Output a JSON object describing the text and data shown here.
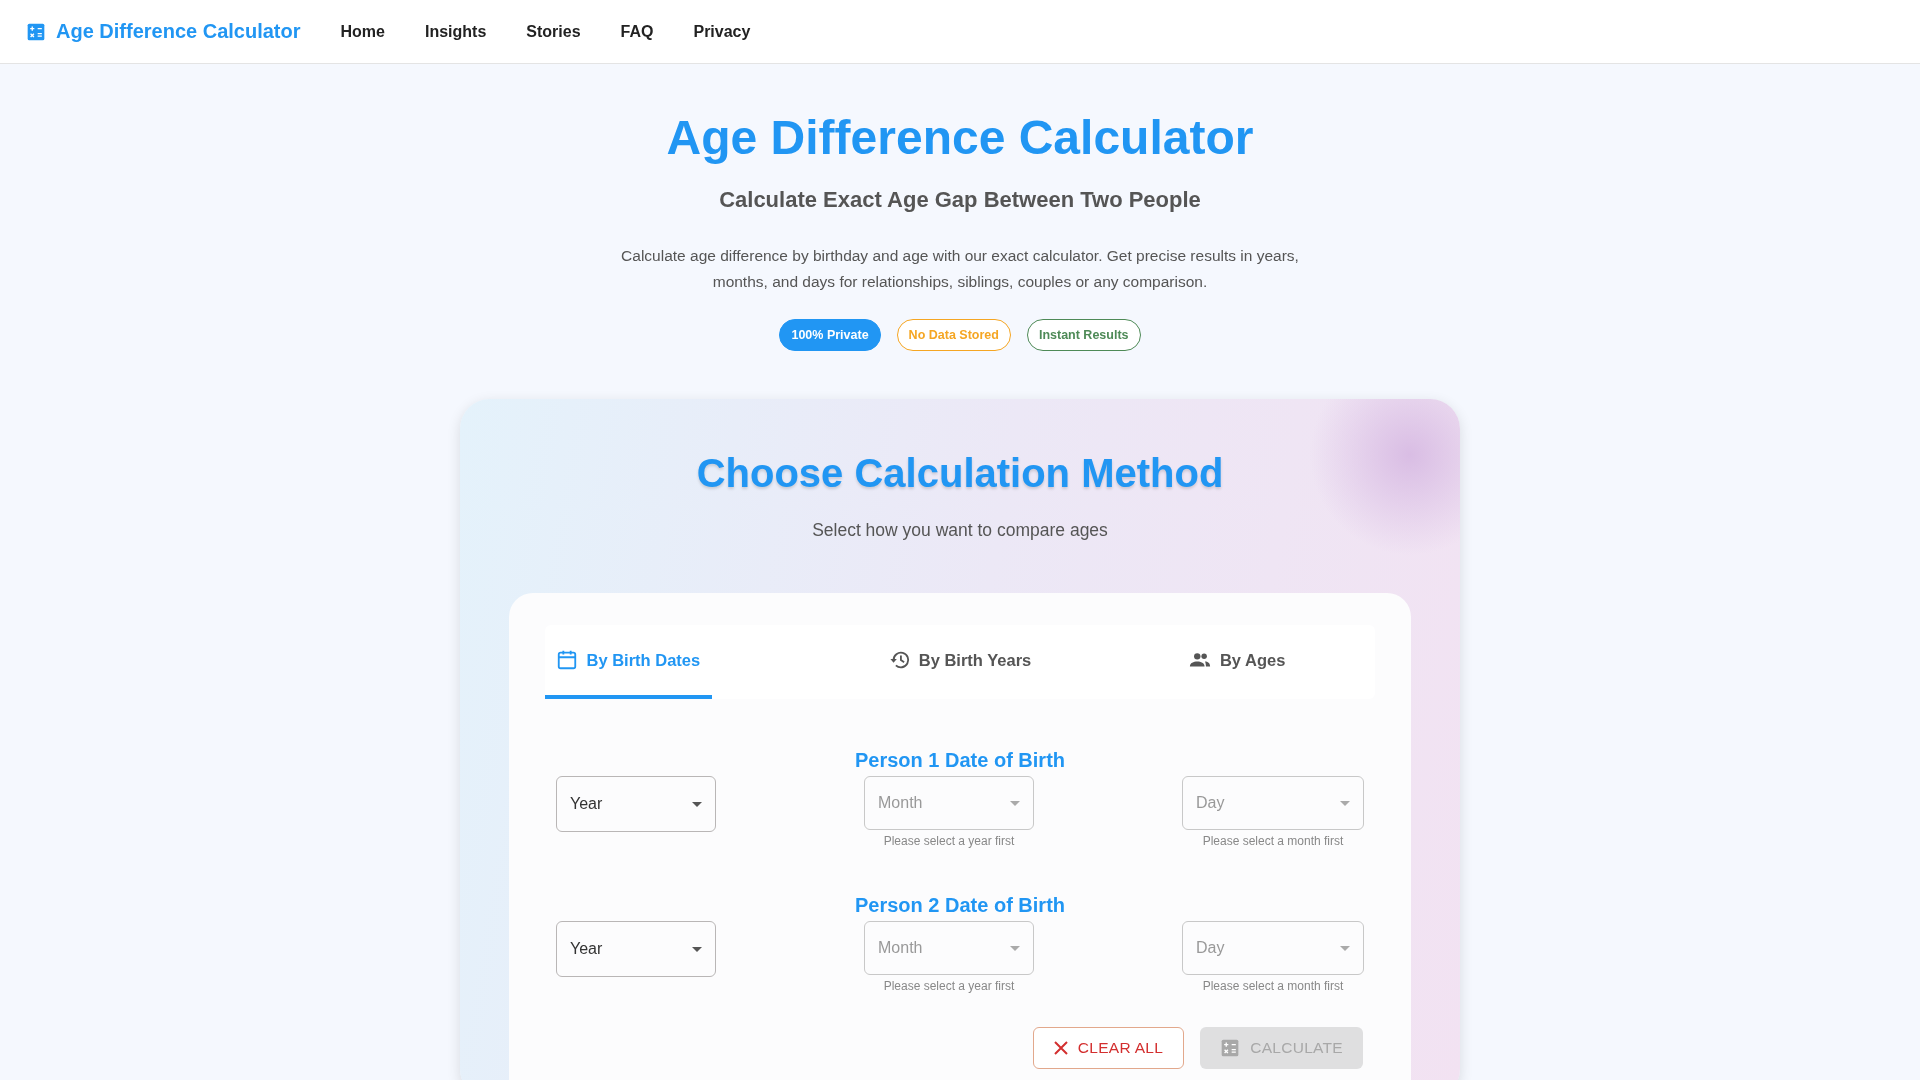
{
  "nav": {
    "brand": "Age Difference Calculator",
    "links": [
      {
        "label": "Home"
      },
      {
        "label": "Insights"
      },
      {
        "label": "Stories"
      },
      {
        "label": "FAQ"
      },
      {
        "label": "Privacy"
      }
    ]
  },
  "hero": {
    "title": "Age Difference Calculator",
    "subtitle": "Calculate Exact Age Gap Between Two People",
    "description": "Calculate age difference by birthday and age with our exact calculator. Get precise results in years, months, and days for relationships, siblings, couples or any comparison.",
    "badges": [
      {
        "label": "100% Private",
        "kind": "filled",
        "color": "#2196f3"
      },
      {
        "label": "No Data Stored",
        "kind": "outline",
        "color": "#f5a623"
      },
      {
        "label": "Instant Results",
        "kind": "outline",
        "color": "#4e8a57"
      }
    ]
  },
  "method": {
    "title": "Choose Calculation Method",
    "subtitle": "Select how you want to compare ages",
    "tabs": [
      {
        "label": "By Birth Dates",
        "selected": true
      },
      {
        "label": "By Birth Years",
        "selected": false
      },
      {
        "label": "By Ages",
        "selected": false
      }
    ],
    "persons": [
      {
        "heading": "Person 1 Date of Birth",
        "fields": [
          {
            "label": "Year",
            "disabled": false
          },
          {
            "label": "Month",
            "disabled": true,
            "helper": "Please select a year first"
          },
          {
            "label": "Day",
            "disabled": true,
            "helper": "Please select a month first"
          }
        ]
      },
      {
        "heading": "Person 2 Date of Birth",
        "fields": [
          {
            "label": "Year",
            "disabled": false
          },
          {
            "label": "Month",
            "disabled": true,
            "helper": "Please select a year first"
          },
          {
            "label": "Day",
            "disabled": true,
            "helper": "Please select a month first"
          }
        ]
      }
    ],
    "buttons": [
      {
        "label": "CLEAR ALL",
        "kind": "clear",
        "disabled": false
      },
      {
        "label": "CALCULATE",
        "kind": "calculate",
        "disabled": true
      }
    ]
  }
}
